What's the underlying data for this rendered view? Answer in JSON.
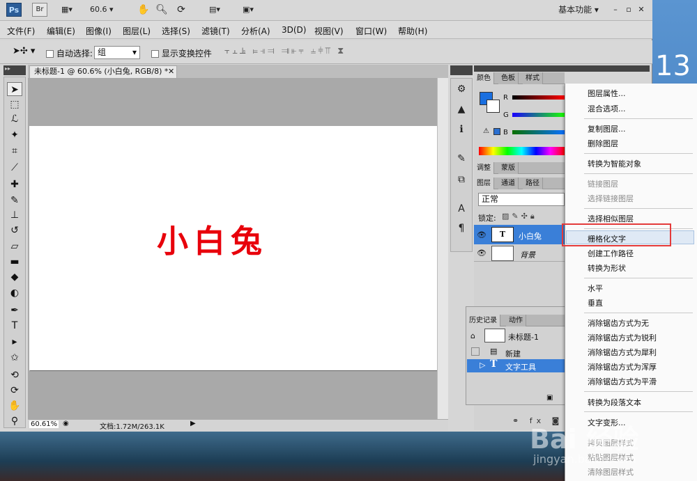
{
  "title_bar": {
    "logo": "Ps",
    "bridge": "Br",
    "zoom": "60.6",
    "workspace": "基本功能"
  },
  "menu_bar": [
    "文件(F)",
    "编辑(E)",
    "图像(I)",
    "图层(L)",
    "选择(S)",
    "滤镜(T)",
    "分析(A)",
    "3D(D)",
    "视图(V)",
    "窗口(W)",
    "帮助(H)"
  ],
  "options_bar": {
    "auto_select_label": "自动选择:",
    "auto_select_value": "组",
    "show_transform_label": "显示变换控件"
  },
  "document": {
    "tab_title": "未标题-1 @ 60.6% (小白兔, RGB/8) *",
    "canvas_text": "小白兔",
    "zoom_status": "60.61%",
    "doc_info": "文档:1.72M/263.1K"
  },
  "color_panel": {
    "tabs": [
      "颜色",
      "色板",
      "样式"
    ],
    "channels": [
      "R",
      "G",
      "B"
    ]
  },
  "adjust_panel": {
    "tabs": [
      "调整",
      "蒙版"
    ]
  },
  "layers_panel": {
    "tabs": [
      "图层",
      "通道",
      "路径"
    ],
    "blend_mode": "正常",
    "lock_label": "锁定:",
    "layers": [
      {
        "name": "小白兔",
        "thumb": "T"
      },
      {
        "name": "背景",
        "thumb": ""
      }
    ]
  },
  "history_panel": {
    "tabs": [
      "历史记录",
      "动作"
    ],
    "snapshot": "未标题-1",
    "items": [
      "新建",
      "文字工具"
    ]
  },
  "context_menu": {
    "items": [
      {
        "label": "图层属性...",
        "disabled": false
      },
      {
        "label": "混合选项...",
        "disabled": false
      },
      {
        "label": "复制图层...",
        "disabled": false
      },
      {
        "label": "删除图层",
        "disabled": false
      },
      {
        "label": "转换为智能对象",
        "disabled": false
      },
      {
        "label": "链接图层",
        "disabled": true
      },
      {
        "label": "选择链接图层",
        "disabled": true
      },
      {
        "label": "选择相似图层",
        "disabled": false
      },
      {
        "label": "栅格化文字",
        "disabled": false
      },
      {
        "label": "创建工作路径",
        "disabled": false
      },
      {
        "label": "转换为形状",
        "disabled": false
      },
      {
        "label": "水平",
        "disabled": false
      },
      {
        "label": "垂直",
        "disabled": false
      },
      {
        "label": "消除锯齿方式为无",
        "disabled": false
      },
      {
        "label": "消除锯齿方式为锐利",
        "disabled": false
      },
      {
        "label": "消除锯齿方式为犀利",
        "disabled": false
      },
      {
        "label": "消除锯齿方式为浑厚",
        "disabled": false
      },
      {
        "label": "消除锯齿方式为平滑",
        "disabled": false
      },
      {
        "label": "转换为段落文本",
        "disabled": false
      },
      {
        "label": "文字变形...",
        "disabled": false
      },
      {
        "label": "拷贝图层样式",
        "disabled": true
      },
      {
        "label": "粘贴图层样式",
        "disabled": true
      },
      {
        "label": "清除图层样式",
        "disabled": true
      }
    ]
  },
  "desktop": {
    "clock": "13"
  },
  "watermark": {
    "brand": "Bai 经验",
    "url": "jingyan.baidu.com"
  },
  "colors": {
    "highlight_border": "#e43a3a",
    "canvas_text": "#e8000b",
    "fg_swatch": "#1a6fe0"
  }
}
